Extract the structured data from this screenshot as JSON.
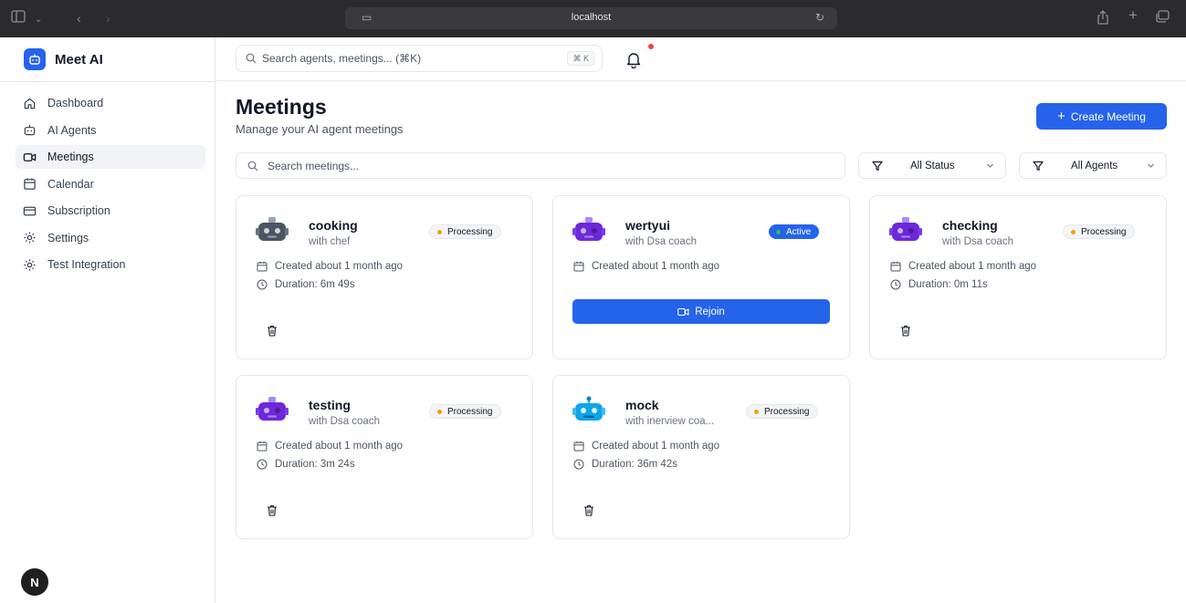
{
  "browser": {
    "url": "localhost"
  },
  "brand": {
    "name": "Meet AI",
    "accent": "#2563eb"
  },
  "sidebar": {
    "items": [
      {
        "label": "Dashboard",
        "icon": "home-icon"
      },
      {
        "label": "AI Agents",
        "icon": "bot-icon"
      },
      {
        "label": "Meetings",
        "icon": "video-icon",
        "active": true
      },
      {
        "label": "Calendar",
        "icon": "calendar-icon"
      },
      {
        "label": "Subscription",
        "icon": "card-icon"
      },
      {
        "label": "Settings",
        "icon": "gear-icon"
      },
      {
        "label": "Test Integration",
        "icon": "gear-icon"
      }
    ],
    "badge_letter": "N"
  },
  "topbar": {
    "search_placeholder": "Search agents, meetings... (⌘K)",
    "shortcut": "⌘ K"
  },
  "main": {
    "title": "Meetings",
    "subtitle": "Manage your AI agent meetings",
    "create_label": "Create Meeting",
    "search_placeholder": "Search meetings...",
    "filters": {
      "status": "All Status",
      "agents": "All Agents"
    }
  },
  "cards": [
    {
      "title": "cooking",
      "agent": "with chef",
      "status": "Processing",
      "created": "Created about 1 month ago",
      "duration": "Duration: 6m 49s",
      "avatar_color": "#4b5563"
    },
    {
      "title": "wertyui",
      "agent": "with Dsa coach",
      "status": "Active",
      "created": "Created about 1 month ago",
      "rejoin_label": "Rejoin",
      "avatar_color": "#6d28d9"
    },
    {
      "title": "checking",
      "agent": "with Dsa coach",
      "status": "Processing",
      "created": "Created about 1 month ago",
      "duration": "Duration: 0m 11s",
      "avatar_color": "#6d28d9"
    },
    {
      "title": "testing",
      "agent": "with Dsa coach",
      "status": "Processing",
      "created": "Created about 1 month ago",
      "duration": "Duration: 3m 24s",
      "avatar_color": "#6d28d9"
    },
    {
      "title": "mock",
      "agent": "with inerview coa...",
      "status": "Processing",
      "created": "Created about 1 month ago",
      "duration": "Duration: 36m 42s",
      "avatar_color": "#0ea5e9"
    }
  ],
  "colors": {
    "processing_dot": "#f59e0b",
    "active_dot": "#22c55e",
    "notification_dot": "#ef4444"
  }
}
